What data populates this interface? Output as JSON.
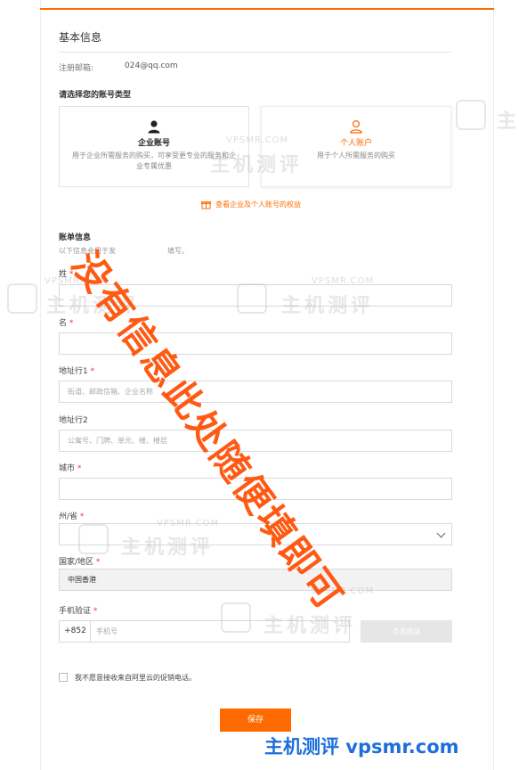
{
  "basic_info": {
    "title": "基本信息",
    "email_label": "注册邮箱:",
    "email_value": "024@qq.com"
  },
  "account_type": {
    "title": "请选择您的账号类型",
    "options": [
      {
        "name": "企业账号",
        "desc": "用于企业所需服务的购买，可享受更专业的服务和企业专属优惠",
        "icon": "user-solid-icon",
        "selected": false
      },
      {
        "name": "个人账户",
        "desc": "用于个人所需服务的购买",
        "icon": "user-outline-icon",
        "selected": true
      }
    ],
    "compare_link": "查看企业及个人账号的权益"
  },
  "billing": {
    "title": "账单信息",
    "subtitle": "以下信息会用于发",
    "subtitle_tail": "填写。",
    "fields": {
      "last_name": {
        "label": "姓",
        "required": "*",
        "placeholder": ""
      },
      "first_name": {
        "label": "名",
        "required": "*",
        "placeholder": ""
      },
      "address1": {
        "label": "地址行1",
        "required": "*",
        "placeholder": "街道、邮政信箱、企业名称"
      },
      "address2": {
        "label": "地址行2",
        "required": "",
        "placeholder": "公寓号、门牌、单元、楼、楼层"
      },
      "city": {
        "label": "城市",
        "required": "*",
        "placeholder": ""
      },
      "province": {
        "label": "州/省",
        "required": "*",
        "value": ""
      },
      "country": {
        "label": "国家/地区",
        "required": "*",
        "value": "中国香港"
      },
      "phone": {
        "label": "手机验证",
        "required": "*",
        "prefix": "+852",
        "placeholder": "手机号",
        "verify_button": "点击验证"
      }
    },
    "promo_opt_out": "我不愿意接收来自阿里云的促销电话。",
    "save_button": "保存"
  },
  "overlay_text": "没有信息此处随便填即可",
  "watermarks": {
    "brand": "主机测评",
    "domain": "VPSMR.COM"
  },
  "bottom_brand": "主机测评 vpsmr.com",
  "colors": {
    "accent": "#ff6a00",
    "overlay": "#ff5a14",
    "brand_blue": "#1e6fd9"
  }
}
